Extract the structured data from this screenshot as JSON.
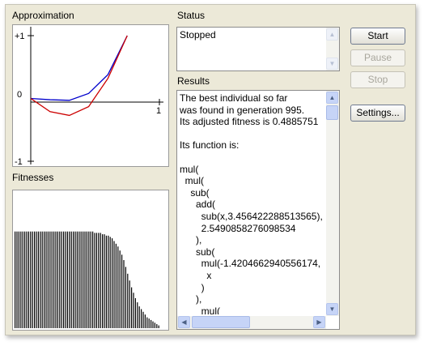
{
  "approximation": {
    "title": "Approximation",
    "y_ticks": [
      "+1",
      "0",
      "-1"
    ],
    "x_tick": "1",
    "chart_data": {
      "type": "line",
      "xlim": [
        -1,
        1
      ],
      "ylim": [
        -1,
        1
      ],
      "series": [
        {
          "color": "#0000cc",
          "x": [
            -1,
            -0.7,
            -0.4,
            -0.1,
            0.2,
            0.5
          ],
          "y": [
            0,
            -0.02,
            -0.03,
            0.08,
            0.38,
            1.0
          ]
        },
        {
          "color": "#cc0000",
          "x": [
            -1,
            -0.7,
            -0.4,
            -0.1,
            0.2,
            0.5
          ],
          "y": [
            0,
            -0.21,
            -0.27,
            -0.13,
            0.32,
            1.0
          ]
        }
      ]
    }
  },
  "fitnesses": {
    "title": "Fitnesses",
    "chart_data": {
      "type": "bar",
      "color": "#000000",
      "values": [
        0.71,
        0.71,
        0.71,
        0.71,
        0.71,
        0.71,
        0.71,
        0.71,
        0.71,
        0.71,
        0.71,
        0.71,
        0.71,
        0.71,
        0.71,
        0.71,
        0.71,
        0.71,
        0.71,
        0.71,
        0.71,
        0.71,
        0.71,
        0.71,
        0.71,
        0.71,
        0.71,
        0.71,
        0.71,
        0.71,
        0.71,
        0.71,
        0.71,
        0.71,
        0.71,
        0.71,
        0.71,
        0.71,
        0.71,
        0.71,
        0.71,
        0.7,
        0.7,
        0.7,
        0.7,
        0.69,
        0.69,
        0.68,
        0.68,
        0.67,
        0.66,
        0.64,
        0.62,
        0.6,
        0.57,
        0.54,
        0.5,
        0.45,
        0.4,
        0.35,
        0.3,
        0.26,
        0.22,
        0.19,
        0.16,
        0.14,
        0.12,
        0.1,
        0.08,
        0.07,
        0.06,
        0.05,
        0.04,
        0.03,
        0.02
      ]
    }
  },
  "status": {
    "title": "Status",
    "text": "Stopped"
  },
  "results": {
    "title": "Results",
    "text": "The best individual so far\nwas found in generation 995.\nIts adjusted fitness is 0.4885751\n\nIts function is:\n\nmul(\n  mul(\n    sub(\n      add(\n        sub(x,3.456422288513565),\n        2.5490858276098534\n      ),\n      sub(\n        mul(-1.4204662940556174,\n          x\n        )\n      ),\n        mul("
  },
  "buttons": {
    "start": "Start",
    "pause": "Pause",
    "stop": "Stop",
    "settings": "Settings..."
  }
}
